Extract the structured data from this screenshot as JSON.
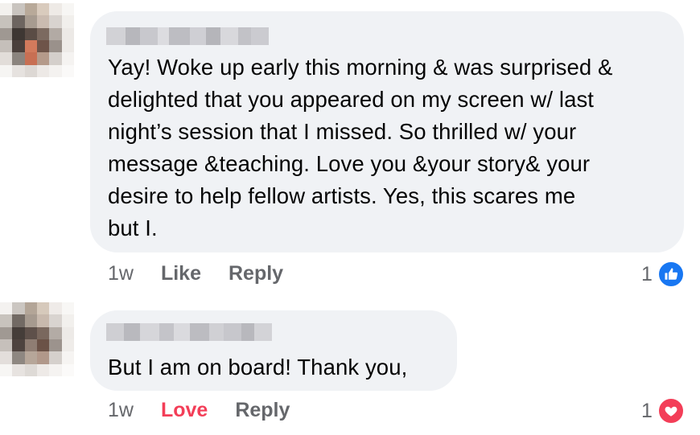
{
  "comments": [
    {
      "text_lines": [
        "Yay! Woke up early this morning & was surprised &",
        "delighted that you appeared on my screen w/ last",
        "night’s session that I missed.  So thrilled w/ your",
        "message &teaching. Love you &your story& your",
        "desire to help fellow artists. Yes, this scares me",
        "but I."
      ],
      "timestamp": "1w",
      "action_label": "Like",
      "reply_label": "Reply",
      "reaction_count": "1",
      "reaction_icon": "like-icon",
      "reaction_color": "#1877f2"
    },
    {
      "text_lines": [
        "But I am on board! Thank you,"
      ],
      "timestamp": "1w",
      "action_label": "Love",
      "reply_label": "Reply",
      "reaction_count": "1",
      "reaction_icon": "heart-icon",
      "reaction_color": "#f33e58"
    }
  ]
}
